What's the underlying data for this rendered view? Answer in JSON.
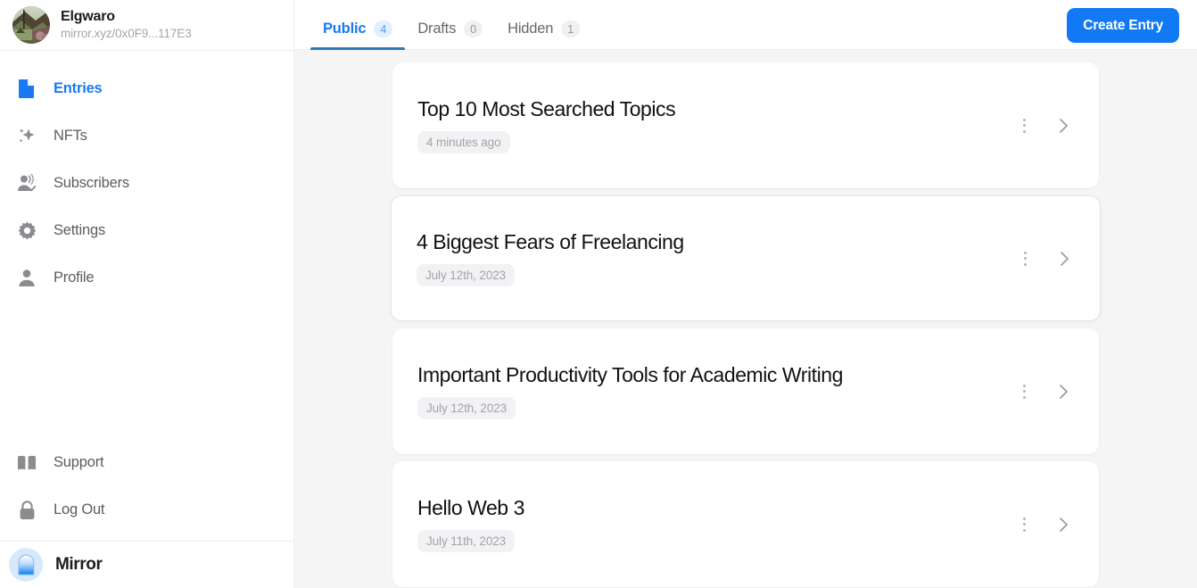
{
  "sidebar": {
    "profile": {
      "name": "Elgwaro",
      "url": "mirror.xyz/0x0F9...117E3",
      "avatar_icon": "profile-photo"
    },
    "items": [
      {
        "label": "Entries",
        "icon": "document-icon",
        "active": true
      },
      {
        "label": "NFTs",
        "icon": "sparkle-icon",
        "active": false
      },
      {
        "label": "Subscribers",
        "icon": "user-check-icon",
        "active": false
      },
      {
        "label": "Settings",
        "icon": "gear-icon",
        "active": false
      },
      {
        "label": "Profile",
        "icon": "person-icon",
        "active": false
      }
    ],
    "bottom_items": [
      {
        "label": "Support",
        "icon": "book-icon"
      },
      {
        "label": "Log Out",
        "icon": "lock-icon"
      }
    ],
    "brand": {
      "label": "Mirror",
      "icon": "mirror-arch-logo"
    }
  },
  "topbar": {
    "tabs": [
      {
        "label": "Public",
        "count": "4",
        "active": true
      },
      {
        "label": "Drafts",
        "count": "0",
        "active": false
      },
      {
        "label": "Hidden",
        "count": "1",
        "active": false
      }
    ],
    "create_button": "Create Entry"
  },
  "entries": [
    {
      "title": "Top 10 Most Searched Topics",
      "date": "4 minutes ago",
      "hovered": false
    },
    {
      "title": "4 Biggest Fears of Freelancing",
      "date": "July 12th, 2023",
      "hovered": true
    },
    {
      "title": "Important Productivity Tools for Academic Writing",
      "date": "July 12th, 2023",
      "hovered": false
    },
    {
      "title": "Hello Web 3",
      "date": "July 11th, 2023",
      "hovered": false
    }
  ],
  "colors": {
    "accent": "#1179f4",
    "active_tab_underline": "#2a7bb8",
    "sidebar_bg": "#ffffff",
    "main_bg": "#f5f5f6",
    "card_bg": "#ffffff",
    "muted_text": "#a3a3a9"
  }
}
